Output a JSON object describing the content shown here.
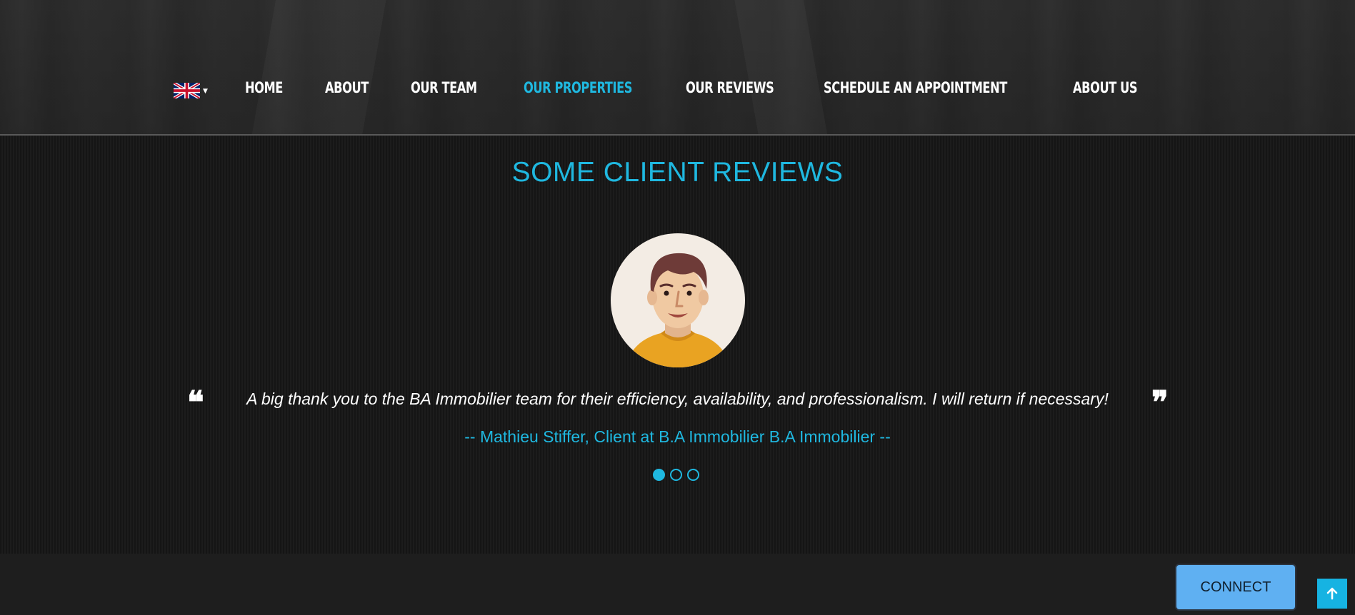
{
  "header": {
    "language": {
      "selected": "English",
      "flag_icon": "uk-flag-icon",
      "caret_icon": "caret-down-icon"
    },
    "nav": [
      {
        "label": "HOME",
        "active": false
      },
      {
        "label": "ABOUT",
        "active": false
      },
      {
        "label": "OUR TEAM",
        "active": false
      },
      {
        "label": "OUR PROPERTIES",
        "active": true
      },
      {
        "label": "OUR REVIEWS",
        "active": false
      },
      {
        "label": "SCHEDULE AN APPOINTMENT",
        "active": false
      },
      {
        "label": "ABOUT US",
        "active": false
      }
    ]
  },
  "reviews": {
    "title": "SOME CLIENT REVIEWS",
    "avatar_icon": "client-avatar-icon",
    "open_quote": "❝",
    "close_quote": "❞",
    "quote": "A big thank you to the BA Immobilier team for their efficiency, availability, and professionalism. I will return if necessary!",
    "author": "-- Mathieu Stiffer, Client at B.A Immobilier B.A Immobilier --",
    "slides_total": 3,
    "active_slide": 1
  },
  "footer": {
    "connect_label": "CONNECT",
    "back_to_top_icon": "arrow-up-icon"
  },
  "colors": {
    "accent": "#1fb8e0",
    "connect_button": "#5fb0f2",
    "background_dark": "#1a1a1a"
  }
}
